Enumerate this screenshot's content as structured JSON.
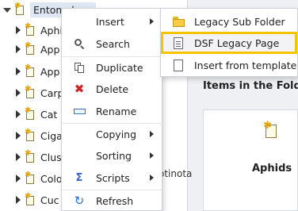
{
  "tree": {
    "root_label": "Entomology",
    "children": [
      "Aphids",
      "App",
      "App",
      "Carp",
      "Cat",
      "Ciga",
      "Clus",
      "Colo",
      "Cuc"
    ]
  },
  "behind_text": "otinota",
  "right_panel": {
    "heading": "Items in the Folde",
    "card_title": "Aphids"
  },
  "context_menu": {
    "items": [
      {
        "label": "Insert",
        "icon": "insert-icon",
        "submenu": true
      },
      {
        "label": "Search",
        "icon": "search-icon",
        "submenu": false
      },
      {
        "label": "Duplicate",
        "icon": "duplicate-icon",
        "submenu": false
      },
      {
        "label": "Delete",
        "icon": "delete-icon",
        "submenu": false
      },
      {
        "label": "Rename",
        "icon": "rename-icon",
        "submenu": false
      },
      {
        "label": "Copying",
        "icon": "",
        "submenu": true
      },
      {
        "label": "Sorting",
        "icon": "",
        "submenu": true
      },
      {
        "label": "Scripts",
        "icon": "scripts-icon",
        "submenu": true
      },
      {
        "label": "Refresh",
        "icon": "refresh-icon",
        "submenu": false
      }
    ]
  },
  "insert_submenu": {
    "items": [
      {
        "label": "Legacy Sub Folder",
        "icon": "folder-icon",
        "highlighted": false
      },
      {
        "label": "DSF Legacy Page",
        "icon": "page-icon",
        "highlighted": true
      },
      {
        "label": "Insert from template",
        "icon": "template-icon",
        "highlighted": false
      }
    ]
  },
  "colors": {
    "highlight_border": "#f5c400",
    "selected_root_bg": "#dde6f2",
    "delete_red": "#d42020"
  }
}
